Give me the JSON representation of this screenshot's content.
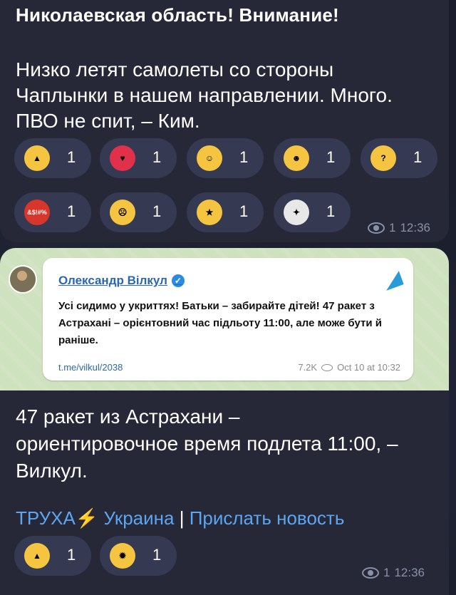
{
  "message1": {
    "title": "Николаевская область! Внимание!",
    "body": "Низко летят самолеты со стороны\nЧаплынки в нашем направлении. Много.\nПВО не спит, – Ким.",
    "reactions": [
      {
        "icon": "thumbs-up-icon",
        "count": "1",
        "color": "#f5c542"
      },
      {
        "icon": "heart-on-fire-icon",
        "count": "1",
        "color": "#e0304a"
      },
      {
        "icon": "smiling-face-with-hearts-icon",
        "count": "1",
        "color": "#f5c542"
      },
      {
        "icon": "grinning-face-icon",
        "count": "1",
        "color": "#f5c542"
      },
      {
        "icon": "thinking-face-icon",
        "count": "1",
        "color": "#f5c542"
      },
      {
        "icon": "face-with-symbols-icon",
        "count": "1",
        "color": "#d9362b",
        "glyph": "&$!#%"
      },
      {
        "icon": "crying-face-icon",
        "count": "1",
        "color": "#f5c542"
      },
      {
        "icon": "star-struck-icon",
        "count": "1",
        "color": "#f5c542"
      },
      {
        "icon": "dove-icon",
        "count": "1",
        "color": "#e8e8e8"
      }
    ],
    "views": "1",
    "time": "12:36"
  },
  "message2": {
    "embed": {
      "author": "Олександр Вілкул",
      "text": "Усі сидимо у укриттях! Батьки – забирайте дітей! 47 ракет з Астрахані – орієнтовний час підльоту 11:00, але може бути й раніше.",
      "link": "t.me/vilkul/2038",
      "views": "7.2K",
      "date": "Oct 10 at 10:32"
    },
    "body": "47 ракет из Астрахани –\nориентировочное время подлета 11:00, –\nВилкул.",
    "signature": {
      "channel": "ТРУХА",
      "bolt": "⚡",
      "region": "Украина",
      "separator": "|",
      "submit": "Прислать новость"
    },
    "reactions": [
      {
        "icon": "thumbs-up-icon",
        "count": "1",
        "color": "#f5c542"
      },
      {
        "icon": "exploding-head-icon",
        "count": "1",
        "color": "#f5c542"
      }
    ],
    "views": "1",
    "time": "12:36"
  }
}
